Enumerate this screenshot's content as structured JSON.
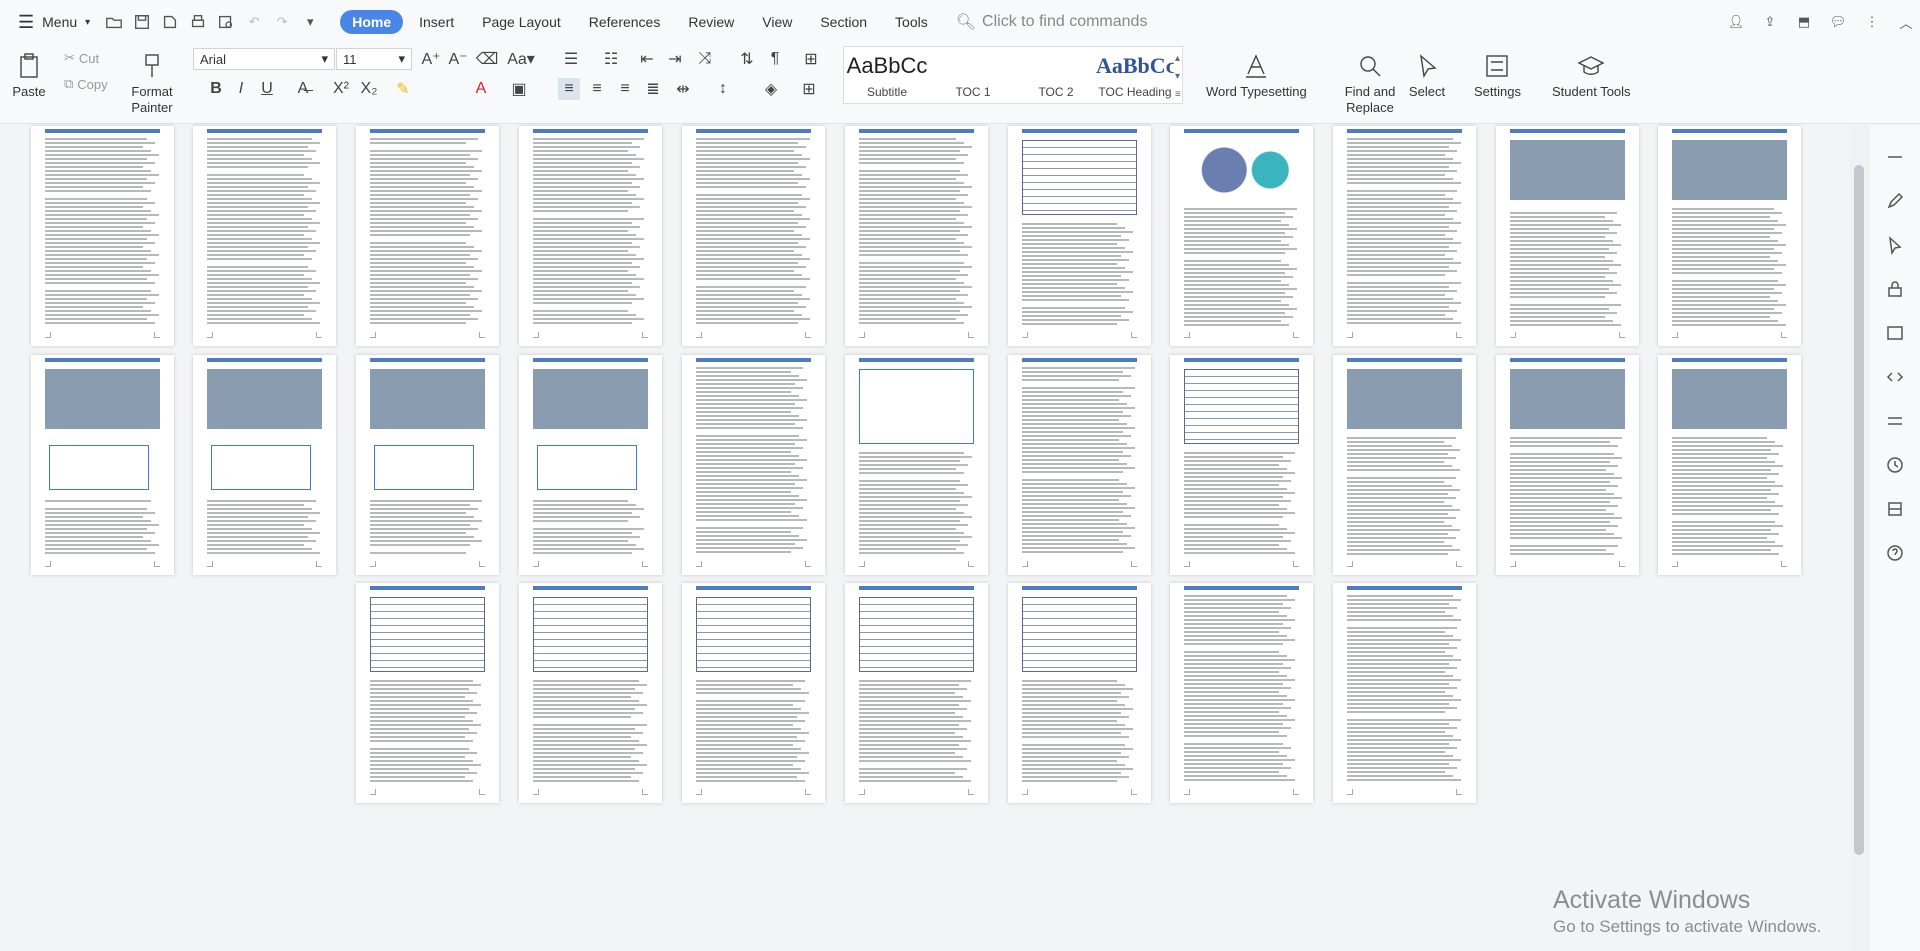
{
  "topbar": {
    "menu_label": "Menu",
    "tabs": [
      "Home",
      "Insert",
      "Page Layout",
      "References",
      "Review",
      "View",
      "Section",
      "Tools"
    ],
    "active_tab": "Home",
    "search_placeholder": "Click to find commands"
  },
  "ribbon": {
    "paste": "Paste",
    "cut": "Cut",
    "copy": "Copy",
    "format_painter": "Format Painter",
    "font_name": "Arial",
    "font_size": "11",
    "styles": [
      {
        "preview": "AaBbCᴄ",
        "label": "Subtitle"
      },
      {
        "preview": "",
        "label": "TOC 1"
      },
      {
        "preview": "",
        "label": "TOC 2"
      },
      {
        "preview": "AaBbCᴄ",
        "label": "TOC Heading"
      }
    ],
    "word_typesetting": "Word Typesetting",
    "find_replace": "Find and Replace",
    "select": "Select",
    "settings": "Settings",
    "student_tools": "Student Tools"
  },
  "watermark": {
    "title": "Activate Windows",
    "subtitle": "Go to Settings to activate Windows."
  },
  "icons": {
    "menu": "hamburger-icon",
    "search": "search-icon",
    "accent": "#4a86e8"
  }
}
